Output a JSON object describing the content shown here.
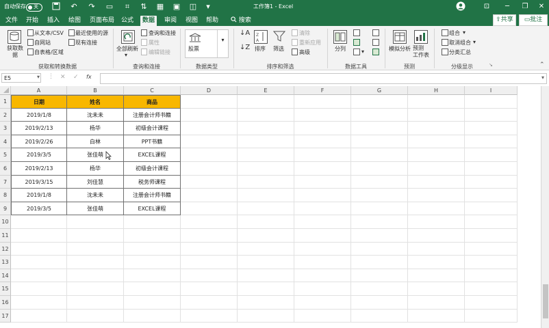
{
  "titlebar": {
    "autosave_label": "自动保存",
    "autosave_state": "关",
    "doc_title": "工作簿1 - Excel",
    "colors": {
      "brand": "#217346",
      "header_fill": "#f8b700"
    }
  },
  "tabs": [
    "文件",
    "开始",
    "插入",
    "绘图",
    "页面布局",
    "公式",
    "数据",
    "审阅",
    "视图",
    "帮助"
  ],
  "active_tab": "数据",
  "search_label": "搜索",
  "share_label": "共享",
  "comment_label": "批注",
  "ribbon": {
    "get_data": "获取数据",
    "from_text": "从文本/CSV",
    "from_web": "自网站",
    "from_table": "自表格/区域",
    "recent_sources": "最近使用的源",
    "existing_connections": "现有连接",
    "group1": "获取和转换数据",
    "refresh_all": "全部刷新",
    "queries_connections": "查询和连接",
    "properties": "属性",
    "edit_links": "编辑链接",
    "group2": "查询和连接",
    "stocks": "股票",
    "group3": "数据类型",
    "sort": "排序",
    "filter": "筛选",
    "clear": "清除",
    "reapply": "重新应用",
    "advanced": "高级",
    "group4": "排序和筛选",
    "text_to_columns": "分列",
    "group5": "数据工具",
    "what_if": "模拟分析",
    "forecast_sheet": "预测\n工作表",
    "group6": "预测",
    "group_btn": "组合",
    "ungroup_btn": "取消组合",
    "subtotal": "分类汇总",
    "group7": "分级显示"
  },
  "formula_bar": {
    "name_box": "E5",
    "fx": "fx",
    "value": ""
  },
  "columns": [
    "A",
    "B",
    "C",
    "D",
    "E",
    "F",
    "G",
    "H",
    "I"
  ],
  "rows": [
    "1",
    "2",
    "3",
    "4",
    "5",
    "6",
    "7",
    "8",
    "9",
    "10",
    "11",
    "12",
    "13",
    "14",
    "15",
    "16",
    "17"
  ],
  "table": {
    "headers": [
      "日期",
      "姓名",
      "商品"
    ],
    "data": [
      [
        "2019/1/8",
        "沈未未",
        "注册会计师书籍"
      ],
      [
        "2019/2/13",
        "杨华",
        "初级会计课程"
      ],
      [
        "2019/2/26",
        "白林",
        "PPT书籍"
      ],
      [
        "2019/3/5",
        "张佳萌",
        "EXCEL课程"
      ],
      [
        "2019/2/13",
        "杨华",
        "初级会计课程"
      ],
      [
        "2019/3/15",
        "刘佳慧",
        "税务师课程"
      ],
      [
        "2019/1/8",
        "沈未未",
        "注册会计师书籍"
      ],
      [
        "2019/3/5",
        "张佳萌",
        "EXCEL课程"
      ]
    ]
  }
}
